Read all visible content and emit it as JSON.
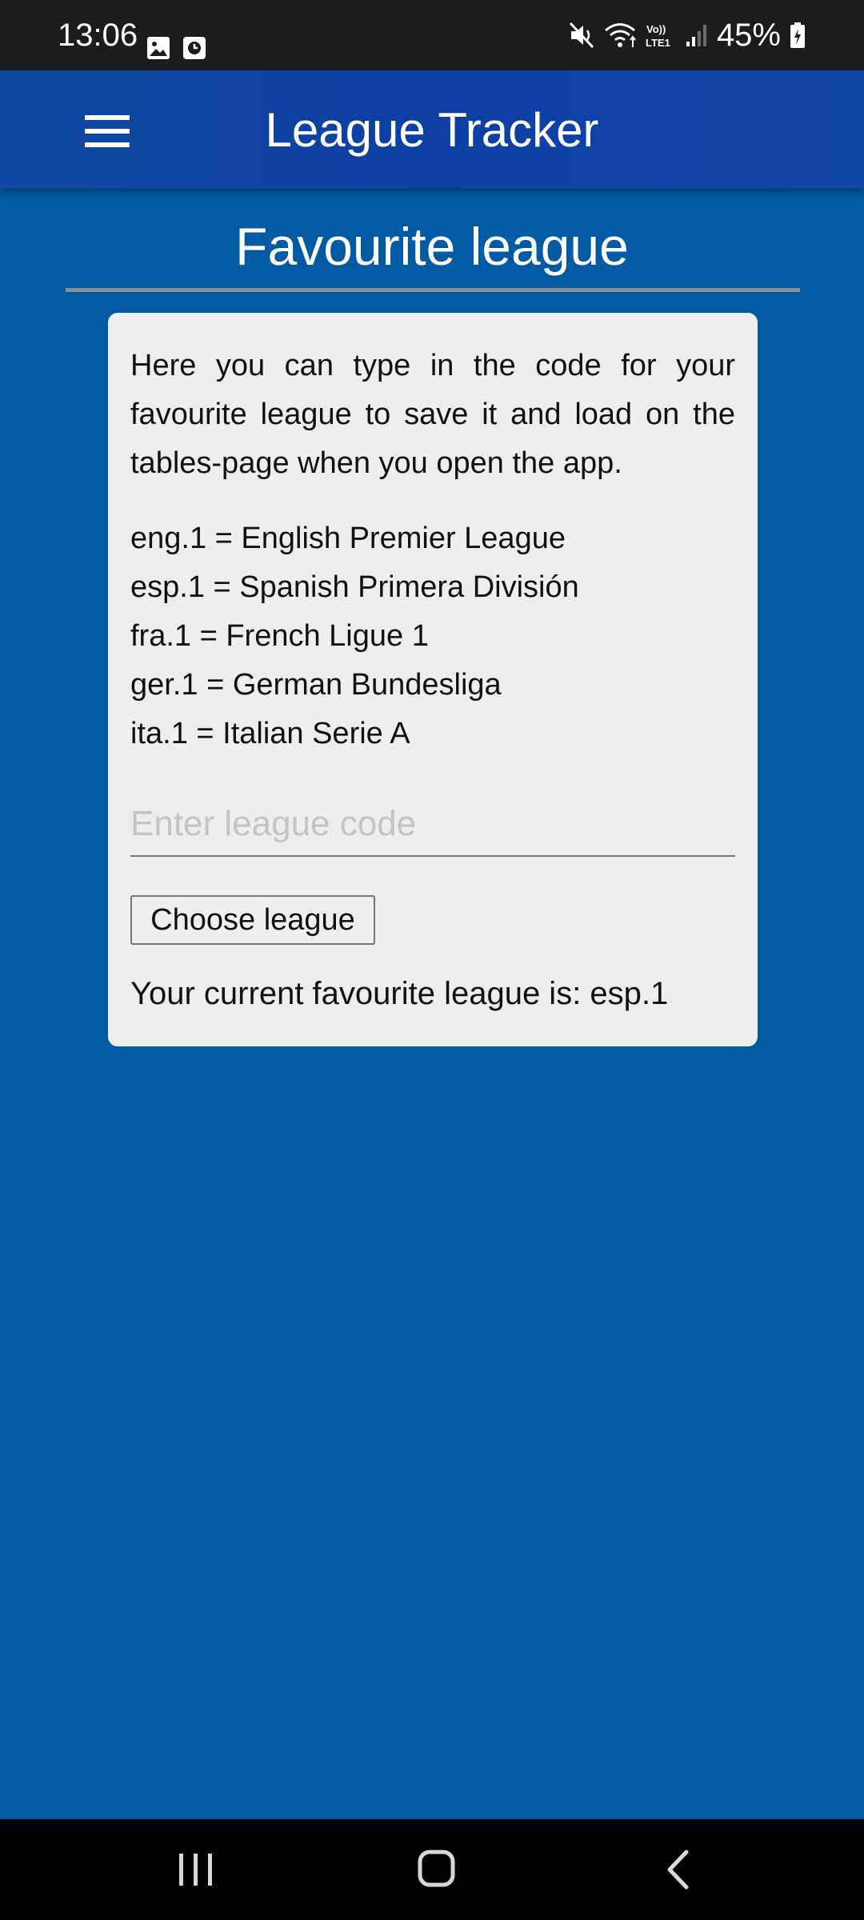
{
  "status_bar": {
    "time": "13:06",
    "battery": "45%",
    "left_icons": [
      "image-icon",
      "clock-icon"
    ],
    "right_icons": [
      "mute-icon",
      "wifi-icon",
      "volte-lte-icon",
      "signal-icon",
      "battery-icon"
    ]
  },
  "app_bar": {
    "title": "League Tracker",
    "menu_icon": "hamburger-menu-icon"
  },
  "page": {
    "title": "Favourite league"
  },
  "card": {
    "intro": "Here you can type in the code for your favourite league to save it and load on the tables-page when you open the app.",
    "codes": [
      "eng.1 = English Premier League",
      "esp.1 = Spanish Primera División",
      "fra.1 = French Ligue 1",
      "ger.1 = German Bundesliga",
      "ita.1 = Italian Serie A"
    ],
    "input_placeholder": "Enter league code",
    "input_value": "",
    "button_label": "Choose league",
    "current_favourite": "Your current favourite league is: esp.1"
  },
  "nav_bar": {
    "buttons": [
      "recent-apps-icon",
      "home-icon",
      "back-icon"
    ]
  },
  "colors": {
    "background": "#015aa2",
    "app_bar": "#0d3fa3",
    "status_bar": "#1b1c1e",
    "card": "#eeeeee",
    "divider": "#8a8f96"
  }
}
